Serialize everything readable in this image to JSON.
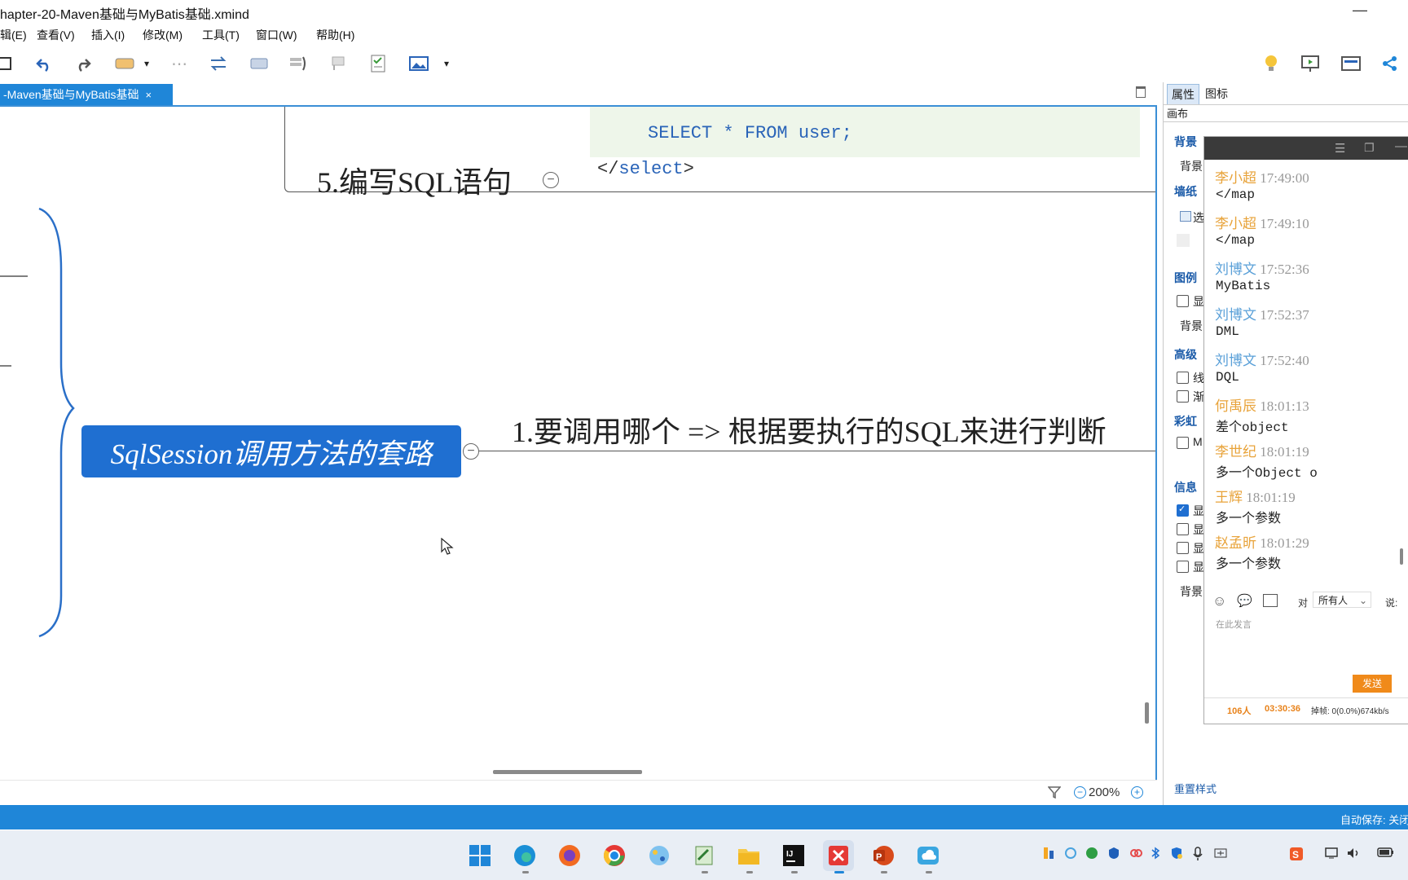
{
  "window": {
    "title": "hapter-20-Maven基础与MyBatis基础.xmind",
    "minimize": "—"
  },
  "menu": [
    {
      "label": "辑(E)"
    },
    {
      "label": "查看(V)"
    },
    {
      "label": "插入(I)"
    },
    {
      "label": "修改(M)"
    },
    {
      "label": "工具(T)"
    },
    {
      "label": "窗口(W)"
    },
    {
      "label": "帮助(H)"
    }
  ],
  "tab": {
    "label": "-Maven基础与MyBatis基础",
    "close": "×"
  },
  "canvas": {
    "code_select": "SELECT * FROM user;",
    "code_close_tag_open": "</",
    "code_close_tag_name": "select",
    "code_close_tag_end": ">",
    "topic_sql": "5.编写SQL语句",
    "central_topic": "SqlSession调用方法的套路",
    "subtopic_1": "1.要调用哪个  =>  根据要执行的SQL来进行判断",
    "collapse_glyph": "−"
  },
  "status": {
    "zoom": "200%"
  },
  "panel": {
    "tabs": [
      "属性",
      "图标"
    ],
    "header": "画布",
    "sections": {
      "background": "背景",
      "background_item": "背景",
      "wallpaper": "墙纸",
      "wallpaper_item": "选",
      "legend": "图例",
      "legend_item": "显",
      "legend_bg": "背景",
      "advanced": "高级",
      "adv_item1": "线",
      "adv_item2": "渐",
      "rainbow": "彩虹",
      "rainbow_item": "M",
      "info": "信息",
      "info_item1": "显",
      "info_item2": "显",
      "info_item3": "显",
      "info_item4": "显",
      "info_bg": "背景"
    },
    "reset": "重置样式"
  },
  "chat": {
    "messages": [
      {
        "name": "李小超",
        "time": "17:49:00",
        "text": "</map",
        "color": "#e8a33a"
      },
      {
        "name": "李小超",
        "time": "17:49:10",
        "text": "</map",
        "color": "#e8a33a"
      },
      {
        "name": "刘博文",
        "time": "17:52:36",
        "text": "MyBatis",
        "color": "#5aa0d8"
      },
      {
        "name": "刘博文",
        "time": "17:52:37",
        "text": "DML",
        "color": "#5aa0d8"
      },
      {
        "name": "刘博文",
        "time": "17:52:40",
        "text": "DQL",
        "color": "#5aa0d8"
      },
      {
        "name": "何禹辰",
        "time": "18:01:13",
        "text": "差个object",
        "color": "#e8a33a"
      },
      {
        "name": "李世纪",
        "time": "18:01:19",
        "text": "多一个Object  o",
        "color": "#e8a33a"
      },
      {
        "name": "王辉",
        "time": "18:01:19",
        "text": "多一个参数",
        "color": "#e8a33a"
      },
      {
        "name": "赵孟昕",
        "time": "18:01:29",
        "text": "多一个参数",
        "color": "#e8a33a"
      }
    ],
    "to_label": "对",
    "recipient": "所有人",
    "say_label": "说:",
    "input_placeholder": "在此发言",
    "send": "发送",
    "count": "106人",
    "duration": "03:30:36",
    "lost_frames": "掉帧: 0(0.0%)674kb/s"
  },
  "footer": {
    "autosave": "自动保存: 关闭"
  },
  "colors": {
    "accent": "#1f86d8",
    "central": "#1f6fd1",
    "code": "#2a64b8"
  }
}
